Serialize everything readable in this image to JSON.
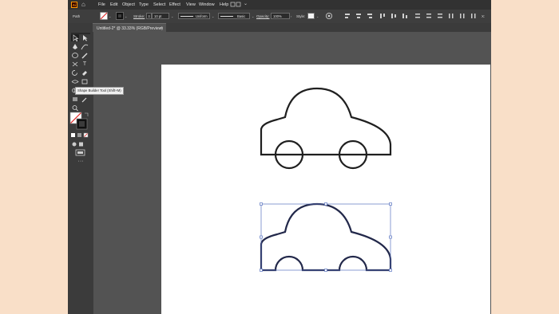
{
  "app": {
    "logo_text": "Ai"
  },
  "menu": [
    "File",
    "Edit",
    "Object",
    "Type",
    "Select",
    "Effect",
    "View",
    "Window",
    "Help"
  ],
  "control_bar": {
    "selection_label": "Path",
    "stroke_label": "Stroke:",
    "stroke_value": "10 pt",
    "profile_value": "Uniform",
    "brush_value": "Basic",
    "opacity_label": "Opacity:",
    "opacity_value": "100%",
    "style_label": "Style:",
    "extra_label": "X:"
  },
  "document_tab": {
    "title": "Untitled-2* @ 33.33% (RGB/Preview)",
    "close_glyph": "×"
  },
  "tooltip": {
    "text": "Shape Builder Tool (Shift+M)"
  },
  "toolbar": {
    "more_glyph": "···"
  },
  "colors": {
    "accent": "#ff9a00",
    "selection_blue": "#5a74c0",
    "app_bg": "#535353",
    "outside_bg": "#f9dfc8",
    "stroke": "#1f1f1f"
  },
  "icons": [
    "selection-arrow-icon",
    "direct-selection-icon",
    "pen-icon",
    "curvature-icon",
    "ellipse-icon",
    "pencil-icon",
    "type-icon",
    "rotate-icon",
    "scale-icon",
    "eraser-icon",
    "width-icon",
    "shape-builder-icon",
    "gradient-icon",
    "eyedropper-icon",
    "zoom-icon",
    "hand-icon",
    "fill-swatch-icon",
    "stroke-swatch-icon",
    "home-icon"
  ]
}
